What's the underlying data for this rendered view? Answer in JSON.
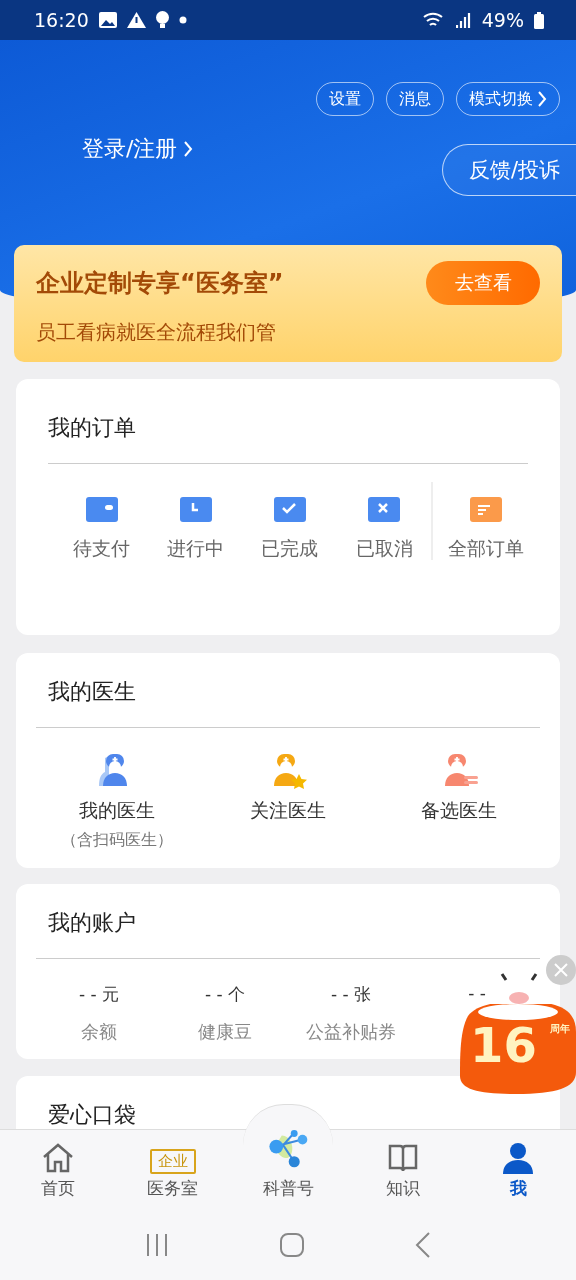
{
  "status_bar": {
    "time": "16:20",
    "battery": "49%"
  },
  "header": {
    "buttons": [
      "设置",
      "消息"
    ],
    "mode_switch": "模式切换",
    "login": "登录/注册",
    "feedback": "反馈/投诉"
  },
  "banner": {
    "title": "企业定制专享“医务室”",
    "subtitle": "员工看病就医全流程我们管",
    "button": "去查看"
  },
  "orders": {
    "title": "我的订单",
    "items": [
      {
        "label": "待支付",
        "kind": "wallet"
      },
      {
        "label": "进行中",
        "kind": "clock"
      },
      {
        "label": "已完成",
        "kind": "check"
      },
      {
        "label": "已取消",
        "kind": "cancel"
      }
    ],
    "all": "全部订单"
  },
  "doctors": {
    "title": "我的医生",
    "items": [
      {
        "label": "我的医生",
        "note": "（含扫码医生）",
        "kind": "mine"
      },
      {
        "label": "关注医生",
        "kind": "star"
      },
      {
        "label": "备选医生",
        "kind": "list"
      }
    ]
  },
  "account": {
    "title": "我的账户",
    "items": [
      {
        "value": "- -",
        "unit": "元",
        "label": "余额"
      },
      {
        "value": "- -",
        "unit": "个",
        "label": "健康豆"
      },
      {
        "value": "- -",
        "unit": "张",
        "label": "公益补贴券"
      },
      {
        "value": "- -"
      }
    ]
  },
  "love": {
    "title": "爱心口袋"
  },
  "promo": {
    "number": "16",
    "suffix": "周年"
  },
  "tabs": [
    {
      "label": "首页",
      "kind": "home",
      "selected": false
    },
    {
      "label": "医务室",
      "kind": "badge",
      "badge": "企业",
      "selected": false
    },
    {
      "label": "科普号",
      "kind": "center",
      "selected": false
    },
    {
      "label": "知识",
      "kind": "book",
      "selected": false
    },
    {
      "label": "我",
      "kind": "person",
      "selected": true
    }
  ]
}
